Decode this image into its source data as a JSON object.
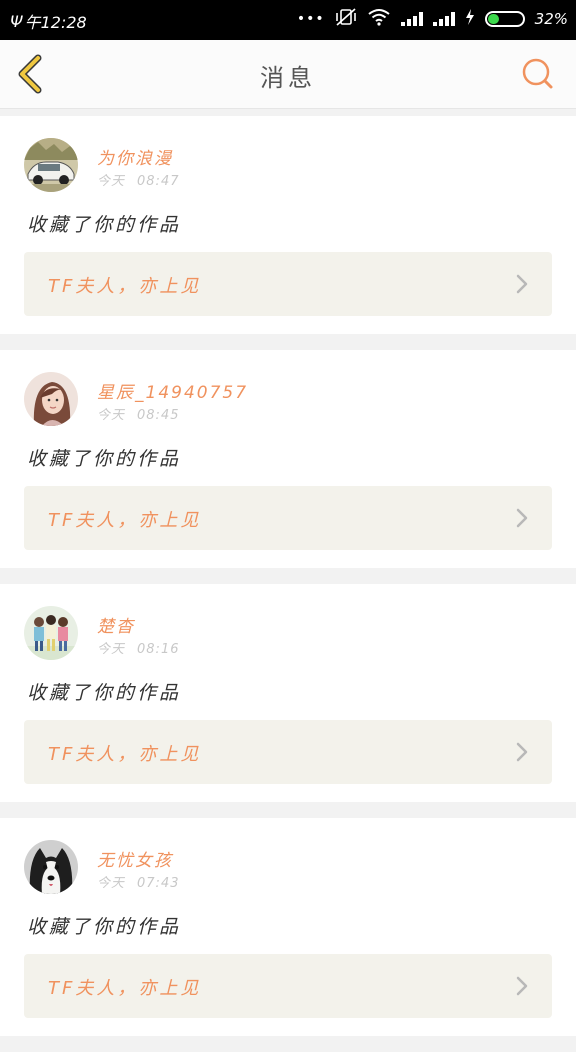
{
  "status_bar": {
    "time": "午12:28",
    "battery": "32%",
    "battery_level": 0.32,
    "dots": "•••",
    "icons": [
      "carrier-icon",
      "vibrate-off-icon",
      "wifi-icon",
      "signal-icon",
      "charging-icon",
      "battery-icon"
    ]
  },
  "header": {
    "title": "消息",
    "back_icon": "chevron-left-icon",
    "search_icon": "search-icon"
  },
  "colors": {
    "accent": "#f0925e",
    "back_arrow": "#f0c840",
    "box_bg": "#f3f2eb",
    "status_bg": "#000000"
  },
  "messages": [
    {
      "username": "为你浪漫",
      "date": "今天",
      "time": "08:47",
      "action": "收藏了你的作品",
      "work_title": "TF夫人，亦上见",
      "avatar": "car-avatar"
    },
    {
      "username": "星辰_14940757",
      "date": "今天",
      "time": "08:45",
      "action": "收藏了你的作品",
      "work_title": "TF夫人，亦上见",
      "avatar": "girl-avatar"
    },
    {
      "username": "楚杳",
      "date": "今天",
      "time": "08:16",
      "action": "收藏了你的作品",
      "work_title": "TF夫人，亦上见",
      "avatar": "group-avatar"
    },
    {
      "username": "无忧女孩",
      "date": "今天",
      "time": "07:43",
      "action": "收藏了你的作品",
      "work_title": "TF夫人，亦上见",
      "avatar": "dog-avatar"
    }
  ]
}
